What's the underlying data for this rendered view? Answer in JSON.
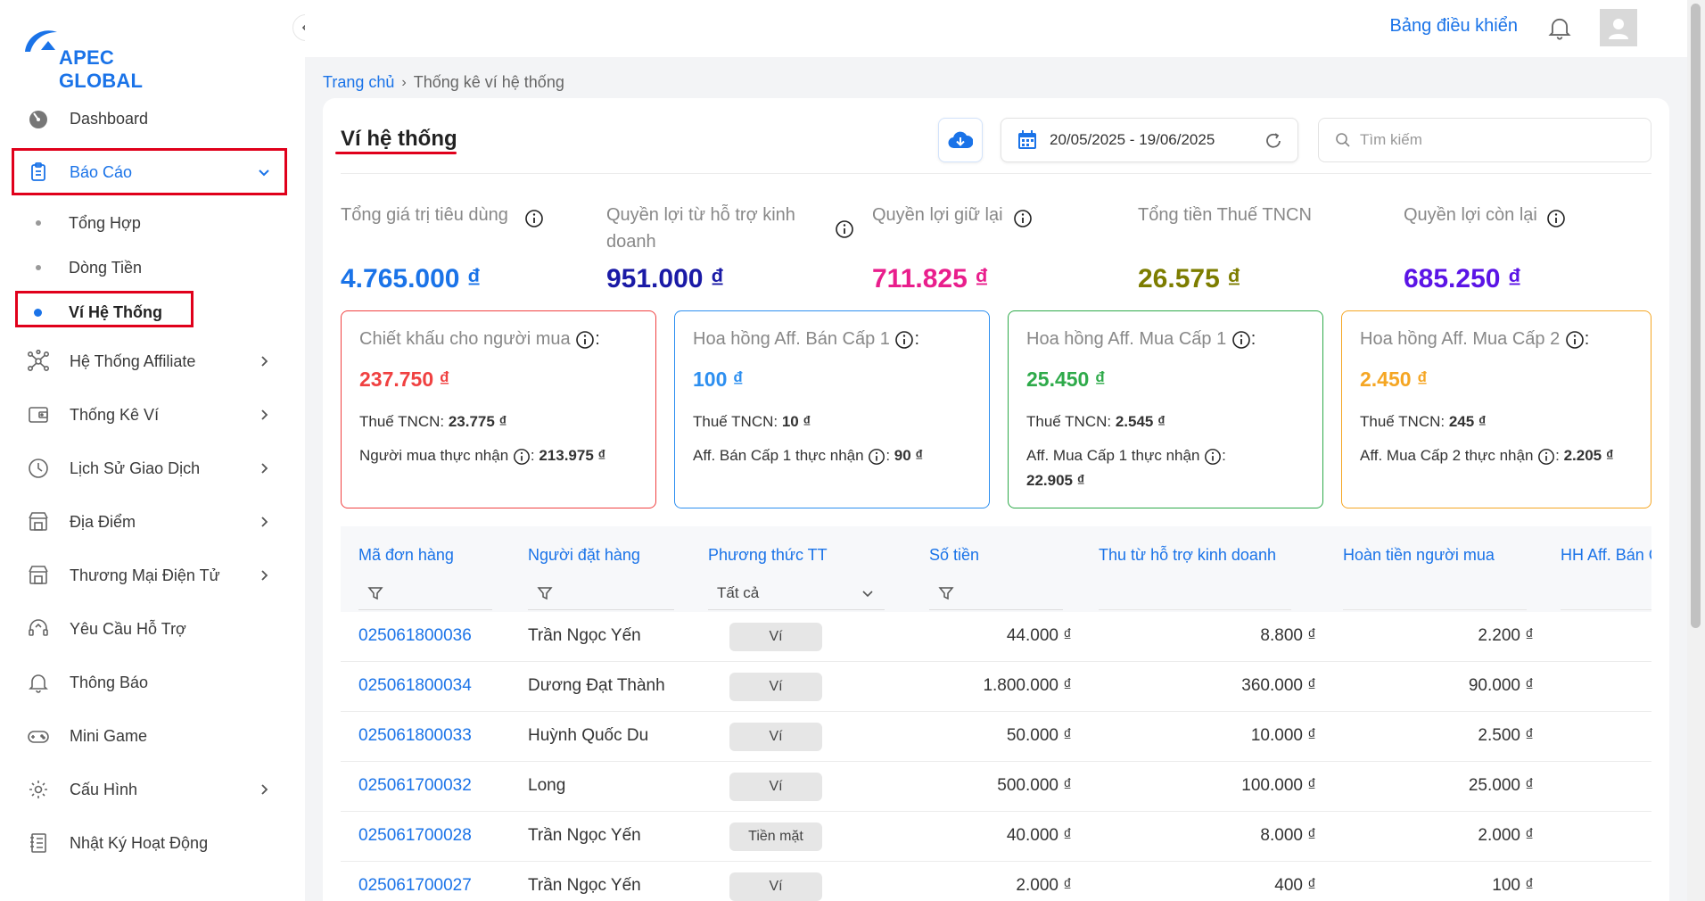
{
  "brand": {
    "name": "APEC GLOBAL"
  },
  "topbar": {
    "dashboard_link": "Bảng điều khiển"
  },
  "sidebar": {
    "items": [
      {
        "label": "Dashboard",
        "icon": "gauge-icon"
      },
      {
        "label": "Báo Cáo",
        "icon": "clipboard-icon"
      },
      {
        "label": "Hệ Thống Affiliate",
        "icon": "network-icon"
      },
      {
        "label": "Thống Kê Ví",
        "icon": "wallet-icon"
      },
      {
        "label": "Lịch Sử Giao Dịch",
        "icon": "clock-icon"
      },
      {
        "label": "Địa Điểm",
        "icon": "store-icon"
      },
      {
        "label": "Thương Mại Điện Tử",
        "icon": "store-icon"
      },
      {
        "label": "Yêu Cầu Hỗ Trợ",
        "icon": "headset-icon"
      },
      {
        "label": "Thông Báo",
        "icon": "bell-icon"
      },
      {
        "label": "Mini Game",
        "icon": "gamepad-icon"
      },
      {
        "label": "Cấu Hình",
        "icon": "gear-icon"
      },
      {
        "label": "Nhật Ký Hoạt Động",
        "icon": "log-icon"
      }
    ],
    "sub_items": [
      {
        "label": "Tổng Hợp"
      },
      {
        "label": "Dòng Tiền"
      },
      {
        "label": "Ví Hệ Thống"
      }
    ]
  },
  "breadcrumb": {
    "home": "Trang chủ",
    "current": "Thống kê ví hệ thống"
  },
  "page": {
    "title": "Ví hệ thống",
    "date_range": "20/05/2025 - 19/06/2025",
    "search_placeholder": "Tìm kiếm"
  },
  "stats": [
    {
      "label": "Tổng giá trị tiêu dùng",
      "value": "4.765.000 ₫",
      "color": "#1a73e8"
    },
    {
      "label": "Quyền lợi từ hỗ trợ kinh doanh",
      "value": "951.000 ₫",
      "color": "#1a1aa6"
    },
    {
      "label": "Quyền lợi giữ lại",
      "value": "711.825 ₫",
      "color": "#e91e8c"
    },
    {
      "label": "Tổng tiền Thuế TNCN",
      "value": "26.575 ₫",
      "color": "#7d7d00"
    },
    {
      "label": "Quyền lợi còn lại",
      "value": "685.250 ₫",
      "color": "#5b14e6"
    }
  ],
  "boxes": [
    {
      "label": "Chiết khấu cho người mua",
      "value": "237.750 ₫",
      "tax_label": "Thuế TNCN:",
      "tax": "23.775 ₫",
      "net_label": "Người mua thực nhận",
      "net": "213.975 ₫",
      "color": "#f04141"
    },
    {
      "label": "Hoa hồng Aff. Bán Cấp 1",
      "value": "100 ₫",
      "tax_label": "Thuế TNCN:",
      "tax": "10 ₫",
      "net_label": "Aff. Bán Cấp 1 thực nhận",
      "net": "90 ₫",
      "color": "#2d8ff0"
    },
    {
      "label": "Hoa hồng Aff. Mua Cấp 1",
      "value": "25.450 ₫",
      "tax_label": "Thuế TNCN:",
      "tax": "2.545 ₫",
      "net_label": "Aff. Mua Cấp 1 thực nhận",
      "net": "22.905 ₫",
      "color": "#2eaa4a"
    },
    {
      "label": "Hoa hồng Aff. Mua Cấp 2",
      "value": "2.450 ₫",
      "tax_label": "Thuế TNCN:",
      "tax": "245 ₫",
      "net_label": "Aff. Mua Cấp 2 thực nhận",
      "net": "2.205 ₫",
      "color": "#f5a623"
    }
  ],
  "table": {
    "headers": [
      "Mã đơn hàng",
      "Người đặt hàng",
      "Phương thức TT",
      "Số tiền",
      "Thu từ hỗ trợ kinh doanh",
      "Hoàn tiền người mua",
      "HH Aff. Bán C"
    ],
    "payment_filter": "Tất cả",
    "rows": [
      {
        "code": "025061800036",
        "customer": "Trần Ngọc Yến",
        "method": "Ví",
        "amount": "44.000 ₫",
        "support": "8.800 ₫",
        "refund": "2.200 ₫"
      },
      {
        "code": "025061800034",
        "customer": "Dương Đạt Thành",
        "method": "Ví",
        "amount": "1.800.000 ₫",
        "support": "360.000 ₫",
        "refund": "90.000 ₫"
      },
      {
        "code": "025061800033",
        "customer": "Huỳnh Quốc Du",
        "method": "Ví",
        "amount": "50.000 ₫",
        "support": "10.000 ₫",
        "refund": "2.500 ₫"
      },
      {
        "code": "025061700032",
        "customer": "Long",
        "method": "Ví",
        "amount": "500.000 ₫",
        "support": "100.000 ₫",
        "refund": "25.000 ₫"
      },
      {
        "code": "025061700028",
        "customer": "Trần Ngọc Yến",
        "method": "Tiền mặt",
        "amount": "40.000 ₫",
        "support": "8.000 ₫",
        "refund": "2.000 ₫"
      },
      {
        "code": "025061700027",
        "customer": "Trần Ngọc Yến",
        "method": "Ví",
        "amount": "2.000 ₫",
        "support": "400 ₫",
        "refund": "100 ₫"
      }
    ]
  }
}
